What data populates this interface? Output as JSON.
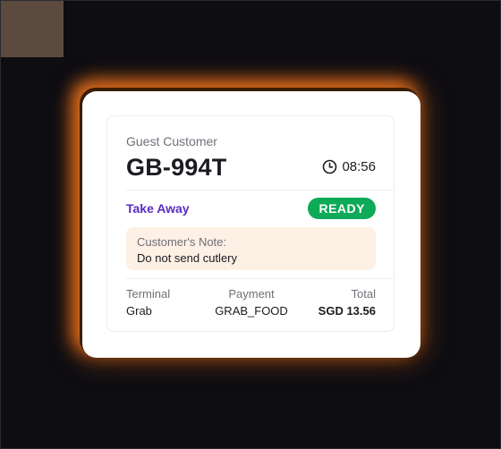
{
  "order": {
    "customer_name": "Guest Customer",
    "code": "GB-994T",
    "time": "08:56",
    "type": "Take Away",
    "status": "READY",
    "note_label": "Customer's Note:",
    "note": "Do not send cutlery"
  },
  "details": {
    "terminal_label": "Terminal",
    "terminal_value": "Grab",
    "payment_label": "Payment",
    "payment_value": "GRAB_FOOD",
    "total_label": "Total",
    "total_value": "SGD 13.56"
  },
  "colors": {
    "background": "#0d0d12",
    "glow": "#e8701c",
    "status_green": "#0eaa57",
    "order_type_purple": "#5a2cc0",
    "note_bg": "#fdf0e4"
  },
  "icons": {
    "time": "clock-icon"
  }
}
